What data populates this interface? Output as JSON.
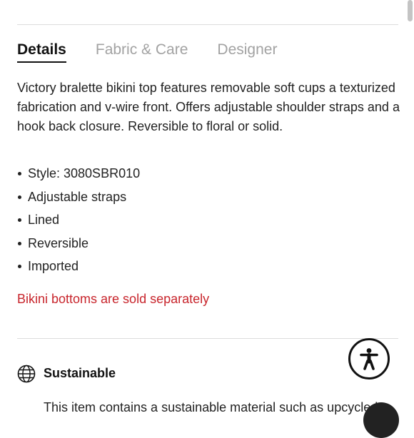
{
  "tabs": [
    {
      "label": "Details",
      "active": true
    },
    {
      "label": "Fabric & Care",
      "active": false
    },
    {
      "label": "Designer",
      "active": false
    }
  ],
  "details": {
    "description": "Victory bralette bikini top features removable soft cups a texturized fabrication and v-wire front. Offers adjustable shoulder straps and a hook back closure. Reversible to floral or solid.",
    "bullets": [
      "Style: 3080SBR010",
      "Adjustable straps",
      "Lined",
      "Reversible",
      "Imported"
    ],
    "note": "Bikini bottoms are sold separately"
  },
  "sustainable": {
    "title": "Sustainable",
    "icon": "globe-icon",
    "text": "This item contains a sustainable material such as upcycled"
  },
  "accessibility": {
    "icon": "accessibility-icon"
  },
  "colors": {
    "note": "#c8252c",
    "divider": "#dcdcdc",
    "inactive_tab": "#a2a2a2"
  }
}
